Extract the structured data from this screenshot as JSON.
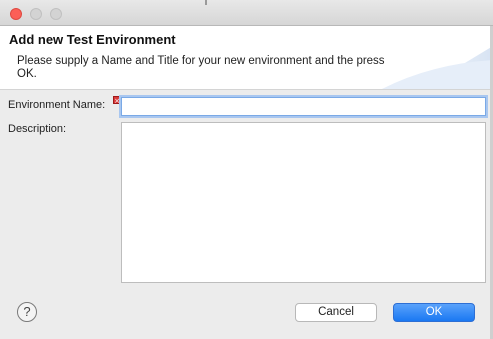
{
  "window": {
    "controls": [
      "close-icon",
      "minimize-icon",
      "zoom-icon"
    ]
  },
  "header": {
    "title": "Add new Test Environment",
    "message": "Please supply a Name and Title for your new environment and the press OK."
  },
  "form": {
    "name_label": "Environment Name:",
    "name_value": "",
    "error_marker": "×",
    "description_label": "Description:",
    "description_value": ""
  },
  "footer": {
    "help_glyph": "?",
    "cancel_label": "Cancel",
    "ok_label": "OK"
  },
  "colors": {
    "ok_button": "#1a78f2",
    "close_button": "#fc5f57",
    "error_marker": "#d83a3a",
    "focus_ring": "#a9c7f0"
  }
}
